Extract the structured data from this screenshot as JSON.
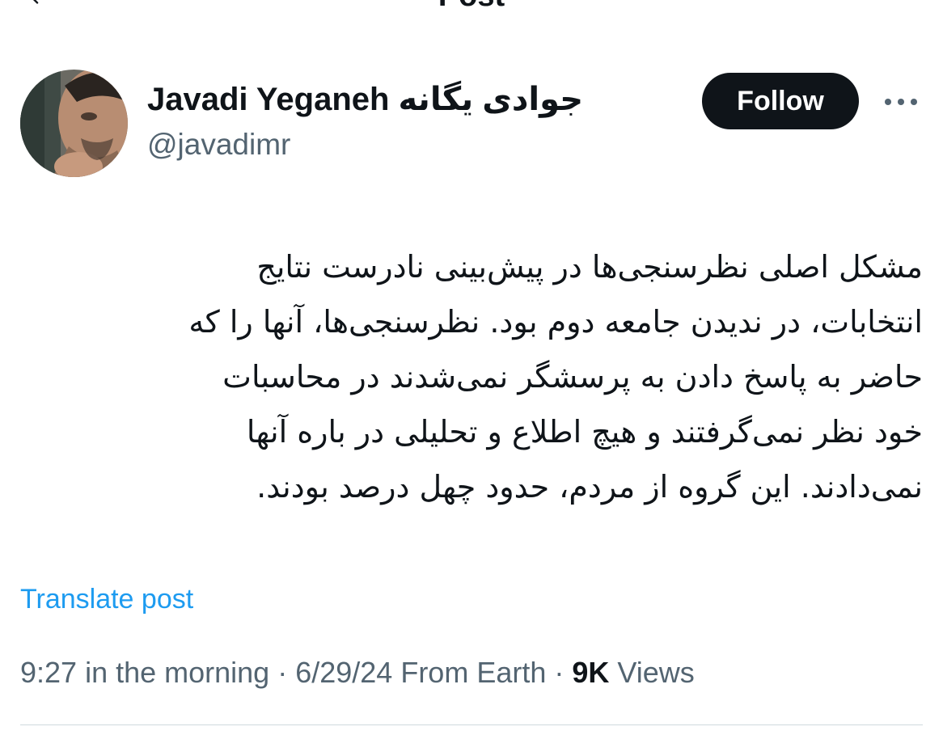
{
  "header": {
    "title": "Post",
    "back_icon": "arrow-left-icon"
  },
  "author": {
    "name": "Javadi Yeganeh جوادی یگانه",
    "handle": "@javadimr",
    "avatar": "profile-photo"
  },
  "actions": {
    "follow_label": "Follow",
    "more_icon": "ellipsis-icon"
  },
  "post": {
    "lines": [
      "مشکل اصلی نظرسنجی‌ها در پیش‌بینی نادرست نتایج",
      "انتخابات، در ندیدن جامعه دوم بود. نظرسنجی‌ها، آنها را که",
      "حاضر به پاسخ دادن به پرسشگر نمی‌شدند در محاسبات",
      "خود نظر نمی‌گرفتند و هیچ  اطلاع و تحلیلی در باره آنها",
      "نمی‌دادند. این گروه از مردم، حدود چهل درصد بودند."
    ],
    "translate_label": "Translate post"
  },
  "meta": {
    "time": "9:27 in the morning",
    "sep1": " · ",
    "date": "6/29/24",
    "source": " From Earth",
    "sep2": " · ",
    "views_count": "9K",
    "views_label": " Views"
  },
  "colors": {
    "text": "#0f1419",
    "secondary": "#536471",
    "link": "#1d9bf0",
    "button_bg": "#0f1419",
    "button_text": "#ffffff",
    "divider": "#cfd9de"
  }
}
